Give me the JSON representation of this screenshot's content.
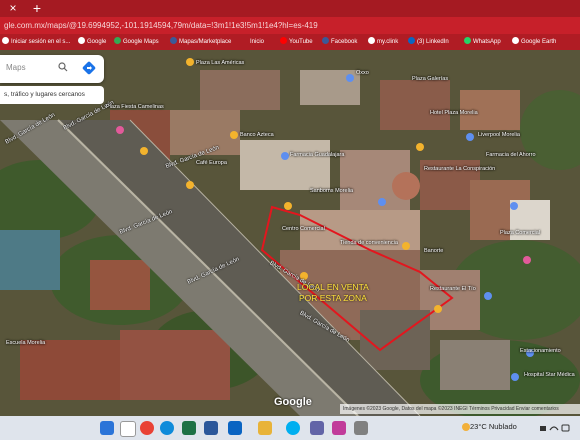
{
  "browser": {
    "close_glyph": "×",
    "new_tab_glyph": "+",
    "url": "gle.com.mx/maps/@19.6994952,-101.1914594,79m/data=!3m1!1e3!5m1!1e4?hl=es-419"
  },
  "bookmarks": [
    {
      "label": "Iniciar sesión en el s...",
      "color": "#ffffff"
    },
    {
      "label": "Google",
      "color": "#ffffff"
    },
    {
      "label": "Google Maps",
      "color": "#ffffff"
    },
    {
      "label": "Mapas/Marketplace",
      "color": "#ffffff"
    },
    {
      "label": "Inicio",
      "color": "#ffffff"
    },
    {
      "label": "YouTube",
      "color": "#ff0000"
    },
    {
      "label": "Facebook",
      "color": "#3b5998"
    },
    {
      "label": "my.clink",
      "color": "#ffffff"
    },
    {
      "label": "(3) LinkedIn",
      "color": "#0a66c2"
    },
    {
      "label": "WhatsApp",
      "color": "#25d366"
    },
    {
      "label": "Google Earth",
      "color": "#ffffff"
    }
  ],
  "search": {
    "placeholder": "Maps",
    "categories": "s, tráfico y lugares cercanos"
  },
  "overlay": {
    "sale_line1": "LOCAL EN VENTA",
    "sale_line2": "POR ESTA ZONA",
    "outline_color": "#e3161e"
  },
  "roads": [
    {
      "label": "Blvd. García de León"
    },
    {
      "label": "Blvd. García de León"
    },
    {
      "label": "Blvd. García de León"
    },
    {
      "label": "Blvd. García de León"
    },
    {
      "label": "Blvd. García de León"
    },
    {
      "label": "Blvd. García de León"
    },
    {
      "label": "Blvd. García de León"
    }
  ],
  "pois": [
    {
      "label": "Plaza Las Américas"
    },
    {
      "label": "Plaza Fiesta Camelinas"
    },
    {
      "label": "Banco Azteca"
    },
    {
      "label": "Farmacia Guadalajara"
    },
    {
      "label": "Café Europa"
    },
    {
      "label": "Oxxo"
    },
    {
      "label": "Plaza Galerías"
    },
    {
      "label": "Liverpool Morelia"
    },
    {
      "label": "Restaurante La Conspiración"
    },
    {
      "label": "Sanborns Morelia"
    },
    {
      "label": "Centro Comercial"
    },
    {
      "label": "Hotel Plaza Morelia"
    },
    {
      "label": "Farmacia del Ahorro"
    },
    {
      "label": "Tienda de conveniencia"
    },
    {
      "label": "Banorte"
    },
    {
      "label": "Restaurante El Tío"
    },
    {
      "label": "Estacionamiento"
    },
    {
      "label": "Plaza Comercial"
    },
    {
      "label": "Hospital Star Médica"
    },
    {
      "label": "Escuela Morelia"
    }
  ],
  "map": {
    "brand": "Google",
    "attribution": "Imágenes ©2023 Google, Datos del mapa ©2023 INEGI  Términos  Privacidad  Enviar comentarios"
  },
  "taskbar": {
    "weather": "23°C  Nublado",
    "icons": [
      "windows-icon",
      "search-icon",
      "chrome-icon",
      "edge-icon",
      "excel-icon",
      "word-icon",
      "mail-icon",
      "files-icon",
      "skype-icon",
      "chat-icon",
      "photos-icon",
      "settings-icon"
    ]
  }
}
